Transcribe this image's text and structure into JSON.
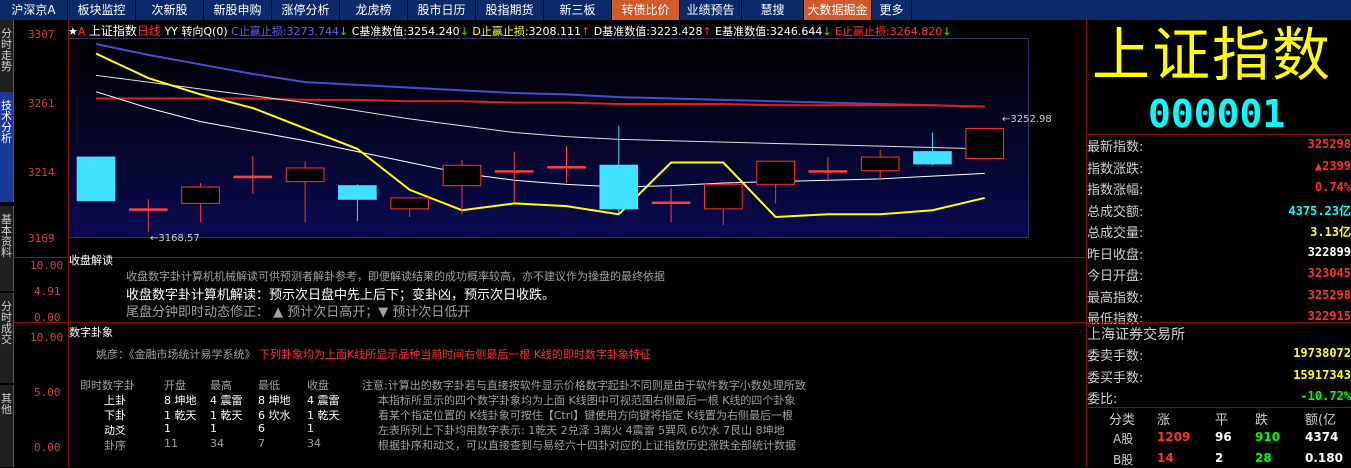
{
  "nav": {
    "items": [
      {
        "label": "沪深京A",
        "w": 68
      },
      {
        "label": "板块监控",
        "w": 68
      },
      {
        "label": "次新股",
        "w": 68
      },
      {
        "label": "新股申购",
        "w": 68
      },
      {
        "label": "涨停分析",
        "w": 68
      },
      {
        "label": "龙虎榜",
        "w": 68
      },
      {
        "label": "股市日历",
        "w": 68
      },
      {
        "label": "股指期货",
        "w": 68
      },
      {
        "label": "新三板",
        "w": 68
      },
      {
        "label": "转债比价",
        "w": 68,
        "hl": true
      },
      {
        "label": "业绩预告",
        "w": 62
      },
      {
        "label": "慧搜",
        "w": 62
      },
      {
        "label": "大数据掘金",
        "w": 68,
        "hl": true
      },
      {
        "label": "更多",
        "w": 40
      }
    ]
  },
  "left_tabs": [
    "分时走势",
    "技术分析",
    "基本资料",
    "分时成交",
    "其他"
  ],
  "chart_header": {
    "name": "上证指数",
    "period": "日线",
    "tag": "YY",
    "indicator": "转向Q(0)",
    "c_label": "C止赢止损:",
    "c_val": "3273.744",
    "c_arrow": "↓",
    "cb_label": "C基准数值:",
    "cb_val": "3254.240",
    "cb_arrow": "↓",
    "d_label": "D止赢止损:",
    "d_val": "3208.111",
    "d_arrow": "↑",
    "db_label": "D基准数值:",
    "db_val": "3223.428",
    "db_arrow": "↑",
    "eb_label": "E基准数值:",
    "eb_val": "3246.644",
    "eb_arrow": "↓",
    "e_label": "E止赢止损:",
    "e_val": "3264.820",
    "e_arrow": "↓"
  },
  "chart_data": {
    "type": "candlestick",
    "y_ticks": [
      "3307",
      "3261",
      "3214",
      "3169"
    ],
    "ylim": [
      3169,
      3307
    ],
    "annot_low": "←3168.57",
    "annot_last": "←3252.98",
    "candles": [
      {
        "o": 3224,
        "c": 3192,
        "h": 3224,
        "l": 3192
      },
      {
        "o": 3186,
        "c": 3186,
        "h": 3193,
        "l": 3169
      },
      {
        "o": 3190,
        "c": 3202,
        "h": 3205,
        "l": 3176
      },
      {
        "o": 3210,
        "c": 3210,
        "h": 3225,
        "l": 3197
      },
      {
        "o": 3206,
        "c": 3216,
        "h": 3221,
        "l": 3176
      },
      {
        "o": 3203,
        "c": 3193,
        "h": 3204,
        "l": 3177
      },
      {
        "o": 3186,
        "c": 3194,
        "h": 3194,
        "l": 3180
      },
      {
        "o": 3203,
        "c": 3218,
        "h": 3222,
        "l": 3182
      },
      {
        "o": 3214,
        "c": 3214,
        "h": 3228,
        "l": 3191
      },
      {
        "o": 3217,
        "c": 3217,
        "h": 3232,
        "l": 3205
      },
      {
        "o": 3218,
        "c": 3186,
        "h": 3247,
        "l": 3182
      },
      {
        "o": 3191,
        "c": 3191,
        "h": 3201,
        "l": 3176
      },
      {
        "o": 3186,
        "c": 3204,
        "h": 3204,
        "l": 3174
      },
      {
        "o": 3204,
        "c": 3221,
        "h": 3221,
        "l": 3190
      },
      {
        "o": 3214,
        "c": 3214,
        "h": 3224,
        "l": 3206
      },
      {
        "o": 3214,
        "c": 3224,
        "h": 3229,
        "l": 3207
      },
      {
        "o": 3228,
        "c": 3219,
        "h": 3242,
        "l": 3218
      },
      {
        "o": 3223,
        "c": 3245,
        "h": 3245,
        "l": 3223
      }
    ],
    "lines": {
      "blue": [
        3307,
        3299,
        3292,
        3285,
        3279,
        3277,
        3275,
        3273,
        3271,
        3270,
        3268,
        3267,
        3266,
        3265,
        3264,
        3263,
        3262,
        3261
      ],
      "red": [
        3267,
        3267,
        3267,
        3267,
        3266,
        3266,
        3265,
        3265,
        3264,
        3264,
        3263,
        3263,
        3263,
        3262,
        3262,
        3262,
        3262,
        3261
      ],
      "white": [
        3284,
        3279,
        3274,
        3269,
        3264,
        3258,
        3252,
        3247,
        3242,
        3239,
        3237,
        3236,
        3235,
        3234,
        3233,
        3232,
        3231,
        3230
      ],
      "white2": [
        3272,
        3260,
        3250,
        3243,
        3236,
        3228,
        3220,
        3212,
        3207,
        3204,
        3202,
        3203,
        3205,
        3206,
        3207,
        3208,
        3210,
        3212
      ],
      "yellow": [
        3300,
        3282,
        3270,
        3260,
        3245,
        3230,
        3200,
        3185,
        3190,
        3188,
        3182,
        3220,
        3220,
        3180,
        3182,
        3182,
        3185,
        3194
      ]
    }
  },
  "panel2": {
    "title": "收盘解读",
    "ticks": [
      "10.00",
      "4.91",
      "0.00"
    ],
    "line1": "收盘数字卦计算机机械解读可供预测者解卦参考，即便解读结果的成功概率较高，亦不建议作为操盘的最终依据",
    "line2": "收盘数字卦计算机解读：预示次日盘中先上后下；变卦凶，预示次日收跌。",
    "line3": "尾盘分钟即时动态修正：  ▲ 预计次日高开；▼ 预计次日低开"
  },
  "panel3": {
    "title": "数字卦象",
    "ticks": [
      "10.00",
      "5.00",
      "0.00"
    ],
    "source_prefix": "姚彦：《金融市场统计易学系统》",
    "source_red": "下列卦象均为上面K线所显示品种当前时间右侧最后一根 K线的即时数字卦象特征",
    "table_headers": [
      "即时数字卦",
      "开盘",
      "最高",
      "最低",
      "收盘"
    ],
    "table_rows": [
      [
        "上卦",
        "8 坤地",
        "4 震雷",
        "8 坤地",
        "4 震雷"
      ],
      [
        "下卦",
        "1 乾天",
        "1 乾天",
        "6 坎水",
        "1 乾天"
      ],
      [
        "动爻",
        "1",
        "1",
        "6",
        "1"
      ],
      [
        "卦序",
        "11",
        "34",
        "7",
        "34"
      ]
    ],
    "notes": [
      "注意:计算出的数字卦若与直接按软件显示价格数字起卦不同则是由于软件数字小数处理所致",
      "本指标所显示的四个数字卦象均为上面 K线图中可视范围右侧最后一根 K线的四个卦象",
      "看某个指定位置的 K线卦象可按住【Ctrl】键使用方向键将指定 K线置为右侧最后一根",
      "左表所列上下卦均用数字表示: 1乾天 2兑泽 3离火 4震雷 5巽风 6坎水 7艮山 8坤地",
      "根据卦序和动爻，可以直接查到与易经六十四卦对应的上证指数历史涨跌全部统计数据"
    ]
  },
  "quote": {
    "big_name": "上证指数",
    "code": "000001",
    "rows": [
      {
        "label": "最新指数:",
        "value": "325298",
        "color": "#ff3030"
      },
      {
        "label": "指数涨跌:",
        "value": "▲2399",
        "color": "#ff3030"
      },
      {
        "label": "指数涨幅:",
        "value": "0.74%",
        "color": "#ff3030"
      },
      {
        "label": "总成交额:",
        "value": "4375.23亿",
        "color": "#00ffff"
      },
      {
        "label": "总成交量:",
        "value": "3.13亿",
        "color": "#ffff00"
      },
      {
        "label": "昨日收盘:",
        "value": "322899",
        "color": "#ffffff"
      },
      {
        "label": "今日开盘:",
        "value": "323045",
        "color": "#ff3030"
      },
      {
        "label": "最高指数:",
        "value": "325298",
        "color": "#ff3030"
      },
      {
        "label": "最低指数:",
        "value": "322915",
        "color": "#ff3030"
      }
    ],
    "exchange": "上海证券交易所",
    "rows2": [
      {
        "label": "委卖手数:",
        "value": "19738072",
        "color": "#ffff00"
      },
      {
        "label": "委买手数:",
        "value": "15917343",
        "color": "#ffff00"
      },
      {
        "label": "委比:",
        "value": "-10.72%",
        "color": "#00ff00"
      }
    ],
    "table_headers": [
      "分类",
      "涨",
      "平",
      "跌",
      "额(亿"
    ],
    "table_rows": [
      {
        "cat": "A股",
        "up": "1209",
        "flat": "96",
        "down": "910",
        "amt": "4374"
      },
      {
        "cat": "B股",
        "up": "14",
        "flat": "2",
        "down": "28",
        "amt": "0.180"
      }
    ]
  }
}
